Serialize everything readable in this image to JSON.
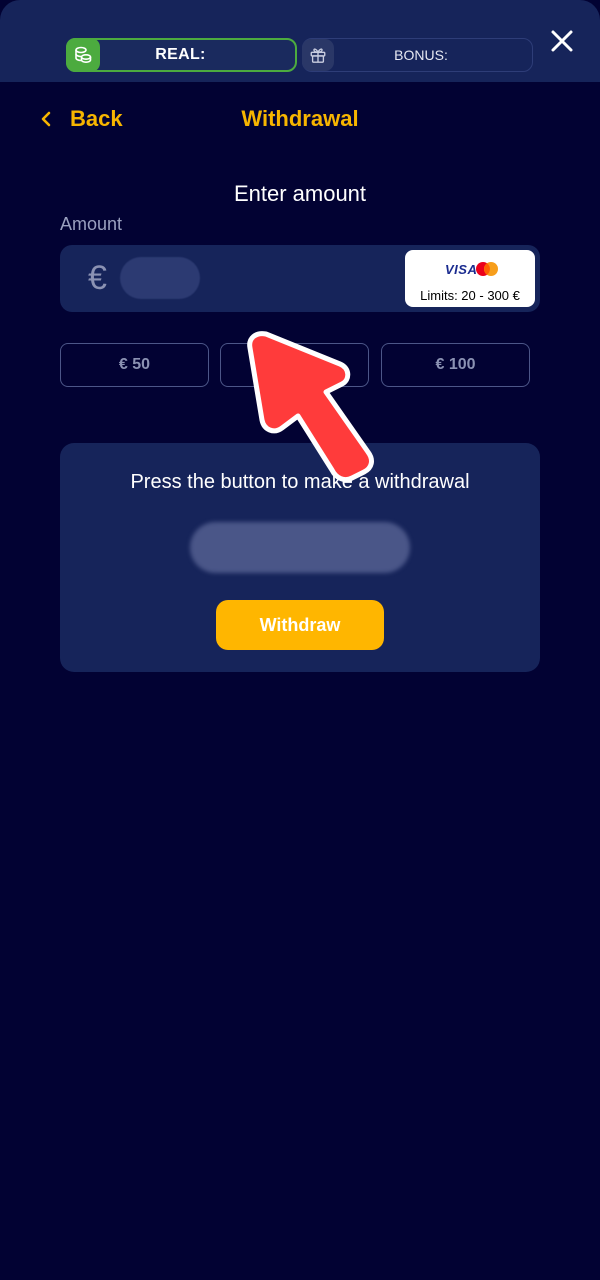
{
  "header": {
    "real_label": "REAL:",
    "bonus_label": "BONUS:"
  },
  "nav": {
    "back_label": "Back",
    "title": "Withdrawal"
  },
  "form": {
    "heading": "Enter amount",
    "amount_label": "Amount",
    "currency_symbol": "€",
    "amount_value": "",
    "payment": {
      "visa_text": "VISA",
      "limits": "Limits: 20 - 300 €"
    },
    "quick_amounts": [
      "€ 50",
      "€ 75",
      "€ 100"
    ]
  },
  "withdraw_card": {
    "instruction": "Press the button to make a withdrawal",
    "button_label": "Withdraw"
  },
  "colors": {
    "background": "#020233",
    "panel": "#16245a",
    "accent": "#f7b500",
    "button": "#ffb600",
    "real_green": "#4cab3f",
    "arrow": "#ff3b3b"
  },
  "icons": {
    "real": "coins-icon",
    "bonus": "gift-icon",
    "close": "close-icon",
    "back": "chevron-left-icon"
  }
}
